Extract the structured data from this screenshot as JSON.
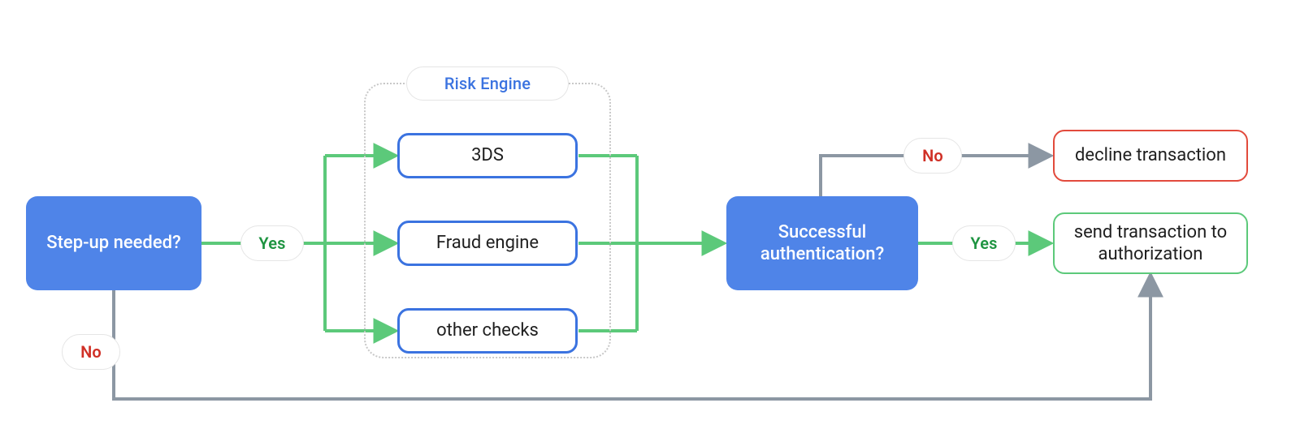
{
  "decision_stepup": "Step-up needed?",
  "decision_auth": "Successful authentication?",
  "risk_engine_title": "Risk Engine",
  "risk_3ds": "3DS",
  "risk_fraud": "Fraud engine",
  "risk_other": "other checks",
  "label_yes": "Yes",
  "label_no": "No",
  "result_decline": "decline transaction",
  "result_authorize": "send transaction to authorization"
}
